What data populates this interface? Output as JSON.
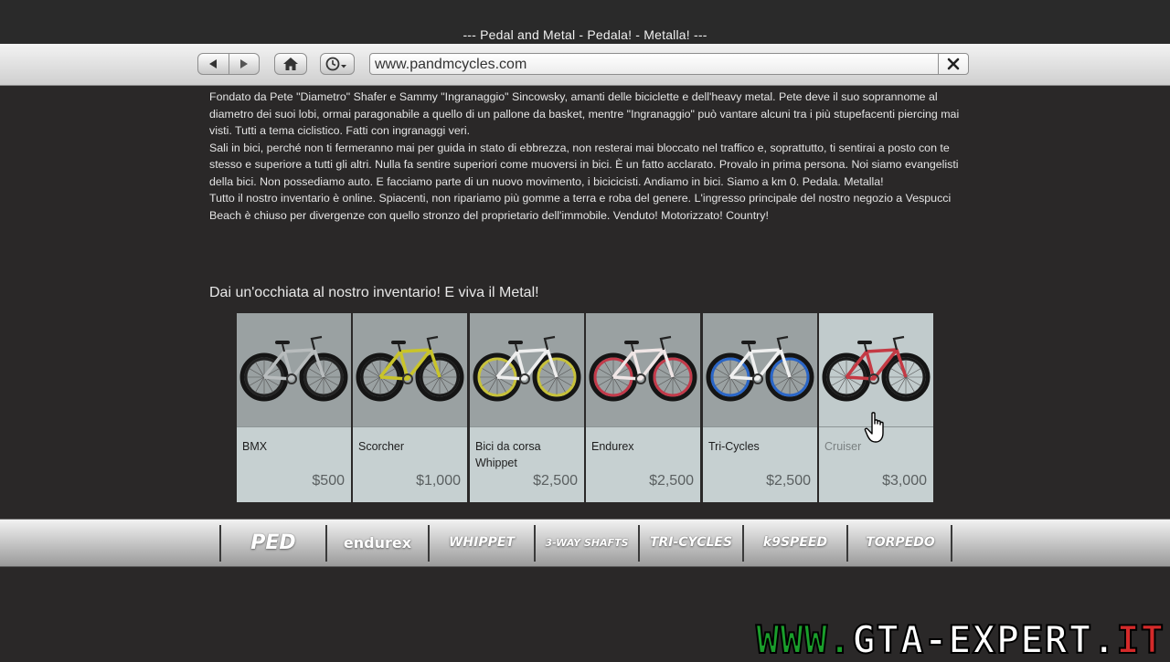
{
  "window": {
    "title": "--- Pedal and Metal - Pedala! - Metalla! ---"
  },
  "toolbar": {
    "back_icon": "back-arrow-icon",
    "forward_icon": "forward-arrow-icon",
    "home_icon": "home-icon",
    "history_icon": "clock-history-icon",
    "url": "www.pandmcycles.com",
    "clear_icon": "close-icon"
  },
  "intro": {
    "paragraphs": [
      "Fondato da Pete \"Diametro\" Shafer e Sammy \"Ingranaggio\" Sincowsky, amanti delle biciclette e dell'heavy metal. Pete deve il suo soprannome al diametro dei suoi lobi, ormai paragonabile a quello di un pallone da basket, mentre \"Ingranaggio\" può vantare alcuni tra i più stupefacenti piercing mai visti. Tutti a tema ciclistico. Fatti con ingranaggi veri.",
      "Sali in bici, perché non ti fermeranno mai per guida in stato di ebbrezza, non resterai mai bloccato nel traffico e, soprattutto, ti sentirai a posto con te stesso e superiore a tutti gli altri. Nulla fa sentire superiori come muoversi in bici. È un fatto acclarato. Provalo in prima persona. Noi siamo evangelisti della bici. Non possediamo auto. E facciamo parte di un nuovo movimento, i bicicicisti. Andiamo in bici. Siamo a km 0. Pedala. Metalla!",
      "Tutto il nostro inventario è online. Spiacenti, non ripariamo più gomme a terra e roba del genere. L'ingresso principale del nostro negozio a Vespucci Beach è chiuso per divergenze con quello stronzo del proprietario dell'immobile. Venduto! Motorizzato! Country!"
    ]
  },
  "inventory": {
    "heading": "Dai un'occhiata al nostro inventario! E viva il Metal!",
    "products": [
      {
        "name": "BMX",
        "price": "$500",
        "frame_color": "#b8bcbd",
        "rim_color": "#222222"
      },
      {
        "name": "Scorcher",
        "price": "$1,000",
        "frame_color": "#c9c42a",
        "rim_color": "#1a1a1a"
      },
      {
        "name": "Bici da corsa Whippet",
        "price": "$2,500",
        "frame_color": "#eeeeee",
        "rim_color": "#c8c23a"
      },
      {
        "name": "Endurex",
        "price": "$2,500",
        "frame_color": "#f0e6e6",
        "rim_color": "#c43a4a"
      },
      {
        "name": "Tri-Cycles",
        "price": "$2,500",
        "frame_color": "#f0f0f0",
        "rim_color": "#2a66c8"
      },
      {
        "name": "Cruiser",
        "price": "$3,000",
        "frame_color": "#c43a44",
        "rim_color": "#1a1a1a"
      }
    ]
  },
  "brands": [
    "PED",
    "endurex",
    "WHIPPET",
    "3-WAY SHAFTS",
    "TRI-CYCLES",
    "k9SPEED",
    "TORPEDO"
  ],
  "watermark": {
    "www": "WWW.",
    "main": "GTA-EXPERT.",
    "it": "IT"
  },
  "cursor_icon": "hand-pointer-icon"
}
